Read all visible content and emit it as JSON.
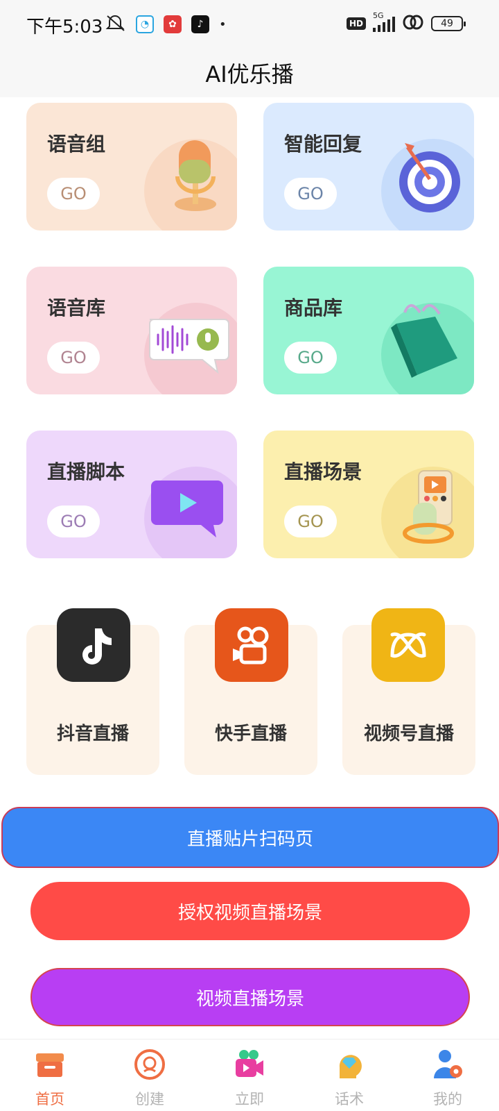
{
  "status_bar": {
    "time": "下午5:03",
    "hd": "HD",
    "network": "5G",
    "battery": "49"
  },
  "header": {
    "title": "AI优乐播"
  },
  "features": [
    {
      "title": "语音组",
      "go": "GO",
      "bg": "#fbe6d6",
      "go_color": "#b88e74",
      "blob": "#f9d9c3",
      "icon": "microphone-icon"
    },
    {
      "title": "智能回复",
      "go": "GO",
      "bg": "#dbeafe",
      "go_color": "#6b84a8",
      "blob": "#c6dcfb",
      "icon": "target-icon"
    },
    {
      "title": "语音库",
      "go": "GO",
      "bg": "#fadbe1",
      "go_color": "#b08390",
      "blob": "#f5c9d1",
      "icon": "voice-bubble-icon"
    },
    {
      "title": "商品库",
      "go": "GO",
      "bg": "#98f5d4",
      "go_color": "#57a98a",
      "blob": "#7de8c3",
      "icon": "shopping-bag-icon"
    },
    {
      "title": "直播脚本",
      "go": "GO",
      "bg": "#eed8fb",
      "go_color": "#9c7cb4",
      "blob": "#e4c6f7",
      "icon": "play-bubble-icon"
    },
    {
      "title": "直播场景",
      "go": "GO",
      "bg": "#fcefae",
      "go_color": "#a49450",
      "blob": "#f7e395",
      "icon": "phone-hand-icon"
    }
  ],
  "platforms": [
    {
      "label": "抖音直播",
      "color": "#2b2b2b",
      "icon": "douyin-icon"
    },
    {
      "label": "快手直播",
      "color": "#e6561b",
      "icon": "kuaishou-icon"
    },
    {
      "label": "视频号直播",
      "color": "#f0b515",
      "icon": "channels-icon"
    }
  ],
  "actions": {
    "sticker_scan": "直播贴片扫码页",
    "authorize_scene": "授权视频直播场景",
    "video_scene": "视频直播场景"
  },
  "tabs": [
    {
      "label": "首页",
      "icon": "home-box-icon",
      "active": true
    },
    {
      "label": "创建",
      "icon": "create-icon",
      "active": false
    },
    {
      "label": "立即",
      "icon": "live-camera-icon",
      "active": false
    },
    {
      "label": "话术",
      "icon": "script-head-icon",
      "active": false
    },
    {
      "label": "我的",
      "icon": "profile-gear-icon",
      "active": false
    }
  ],
  "colors": {
    "accent": "#ef6e43",
    "blue": "#3b87f5",
    "red": "#ff4b47",
    "purple": "#b83ef3"
  }
}
